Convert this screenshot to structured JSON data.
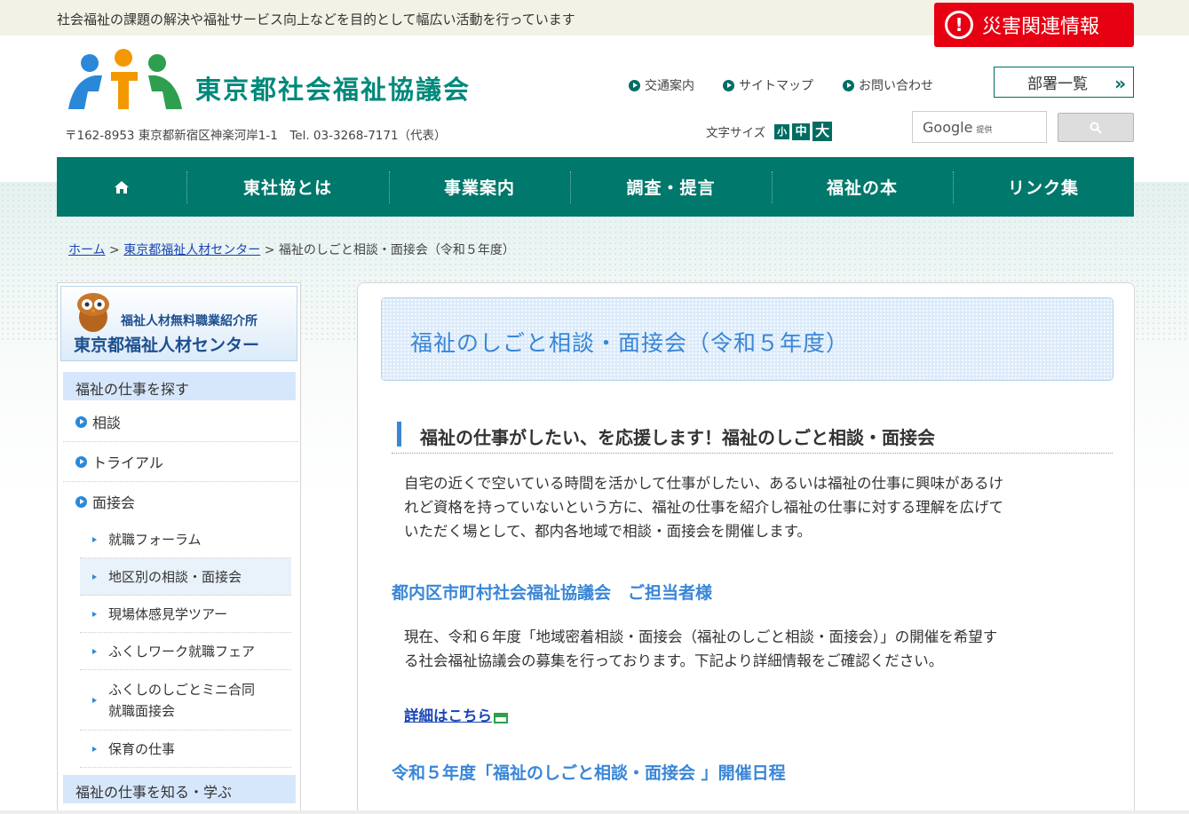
{
  "header": {
    "tagline": "社会福祉の課題の解決や福祉サービス向上などを目的として幅広い活動を行っています",
    "disaster_icon": "!",
    "disaster_label": "災害関連情報",
    "logo_text": "東京都社会福祉協議会",
    "address": "〒162-8953 東京都新宿区神楽河岸1-1　Tel. 03-3268-7171（代表）",
    "util_links": [
      "交通案内",
      "サイトマップ",
      "お問い合わせ"
    ],
    "dept_button": "部署一覧",
    "dept_chevron": "»",
    "font_size_label": "文字サイズ",
    "font_sizes": [
      "小",
      "中",
      "大"
    ],
    "search_brand": "Google",
    "search_provided": "提供"
  },
  "nav": {
    "items": [
      "東社協とは",
      "事業案内",
      "調査・提言",
      "福祉の本",
      "リンク集"
    ]
  },
  "breadcrumb": {
    "home": "ホーム",
    "sep": ">",
    "parent": "東京都福祉人材センター",
    "current": "福祉のしごと相談・面接会（令和５年度）"
  },
  "sidebar": {
    "banner_sub": "福祉人材無料職業紹介所",
    "banner_main": "東京都福祉人材センター",
    "heading1": "福祉の仕事を探す",
    "items": [
      "相談",
      "トライアル",
      "面接会"
    ],
    "subitems": [
      "就職フォーラム",
      "地区別の相談・面接会",
      "現場体感見学ツアー",
      "ふくしワーク就職フェア",
      "ふくしのしごとミニ合同",
      "就職面接会",
      "保育の仕事"
    ],
    "heading2": "福祉の仕事を知る・学ぶ"
  },
  "main": {
    "title": "福祉のしごと相談・面接会（令和５年度）",
    "h2": "福祉の仕事がしたい、を応援します！福祉のしごと相談・面接会",
    "intro_lines": [
      "自宅の近くで空いている時間を活かして仕事がしたい、あるいは福祉の仕事に興味があるけ",
      "れど資格を持っていないという方に、福祉の仕事を紹介し福祉の仕事に対する理解を広げて",
      "いただく場として、都内各地域で相談・面接会を開催します。"
    ],
    "h3_1": "都内区市町村社会福祉協議会　ご担当者様",
    "notice_lines": [
      "現在、令和６年度「地域密着相談・面接会（福祉のしごと相談・面接会）」の開催を希望す",
      "る社会福祉協議会の募集を行っております。下記より詳細情報をご確認ください。"
    ],
    "detail_link": "詳細はこちら",
    "h3_2": "令和５年度「福祉のしごと相談・面接会 」開催日程"
  },
  "colors": {
    "brand_green": "#00786b",
    "accent_blue": "#3a86d6",
    "disaster_red": "#e60012"
  }
}
